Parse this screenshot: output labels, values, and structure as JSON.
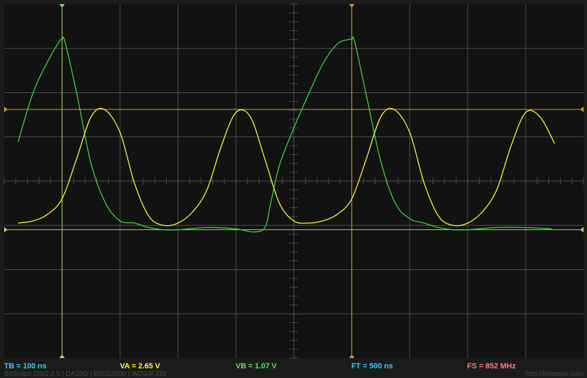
{
  "app": {
    "version_info": "BitScope DSO 2.5 | DA15G | BS012000 | WD34FJ33",
    "website": "http://bitscope.com"
  },
  "readouts": {
    "timebase": "TB = 100 ns",
    "channel_a": "VA = 2.65 V",
    "channel_b": "VB = 1.07 V",
    "frame_time": "FT = 500 ns",
    "sample_rate": "FS = 852 MHz"
  },
  "colors": {
    "background": "#121212",
    "grid": "#4d4d4d",
    "channel_a": "#ffff33",
    "channel_b": "#33dd33",
    "cursor_a": "#d4a020",
    "cursor_b": "#a6d86a",
    "timebase_text": "#33ccff",
    "channel_a_text": "#ffff33",
    "channel_b_text": "#55ee55",
    "frame_time_text": "#33ccff",
    "sample_rate_text": "#ff8080"
  },
  "chart_data": {
    "type": "line",
    "grid": true,
    "xlim": [
      0,
      10
    ],
    "ylim": [
      -4,
      4
    ],
    "cursors": {
      "vertical": [
        {
          "id": "cursor-b-vertical",
          "x": 1.0,
          "color": "cursor_b"
        },
        {
          "id": "cursor-a-vertical",
          "x": 6.0,
          "color": "cursor_a"
        }
      ],
      "horizontal": [
        {
          "id": "cursor-a-horizontal",
          "y": 1.62,
          "color": "cursor_a"
        },
        {
          "id": "cursor-b-horizontal",
          "y": -1.1,
          "color": "cursor_b"
        }
      ]
    },
    "series": [
      {
        "id": "channel-b-trace",
        "color": "channel_b",
        "x": [
          0.24,
          0.5,
          0.75,
          0.95,
          1.0,
          1.05,
          1.25,
          1.5,
          1.75,
          2.0,
          2.25,
          2.5,
          2.75,
          3.0,
          3.5,
          4.0,
          4.3,
          4.5,
          4.6,
          4.75,
          5.0,
          5.25,
          5.5,
          5.75,
          5.95,
          6.0,
          6.05,
          6.25,
          6.5,
          6.75,
          7.0,
          7.25,
          7.5,
          7.75,
          8.0,
          8.5,
          9.0,
          9.45
        ],
        "y": [
          0.88,
          2.0,
          2.7,
          3.15,
          3.2,
          3.15,
          2.0,
          0.4,
          -0.5,
          -0.9,
          -0.95,
          -1.05,
          -1.1,
          -1.1,
          -1.05,
          -1.08,
          -1.15,
          -1.05,
          -0.5,
          0.35,
          1.2,
          1.95,
          2.65,
          3.1,
          3.2,
          3.2,
          3.15,
          1.95,
          0.45,
          -0.5,
          -0.85,
          -0.95,
          -1.05,
          -1.1,
          -1.1,
          -1.05,
          -1.05,
          -1.08
        ]
      },
      {
        "id": "channel-a-trace",
        "color": "channel_a",
        "x": [
          0.24,
          0.5,
          0.75,
          1.0,
          1.25,
          1.5,
          1.73,
          2.0,
          2.25,
          2.5,
          2.75,
          3.0,
          3.25,
          3.5,
          3.75,
          4.0,
          4.25,
          4.5,
          4.75,
          5.0,
          5.25,
          5.5,
          5.75,
          6.0,
          6.25,
          6.5,
          6.73,
          7.0,
          7.25,
          7.5,
          7.75,
          8.0,
          8.25,
          8.5,
          8.75,
          9.0,
          9.25,
          9.5
        ],
        "y": [
          -0.95,
          -0.9,
          -0.75,
          -0.4,
          0.5,
          1.45,
          1.62,
          1.1,
          -0.05,
          -0.8,
          -1.0,
          -0.95,
          -0.7,
          -0.2,
          0.8,
          1.55,
          1.45,
          0.5,
          -0.5,
          -0.9,
          -0.95,
          -0.9,
          -0.75,
          -0.4,
          0.5,
          1.45,
          1.62,
          1.1,
          -0.05,
          -0.8,
          -1.0,
          -0.95,
          -0.7,
          -0.2,
          0.8,
          1.55,
          1.45,
          0.85
        ]
      }
    ]
  }
}
